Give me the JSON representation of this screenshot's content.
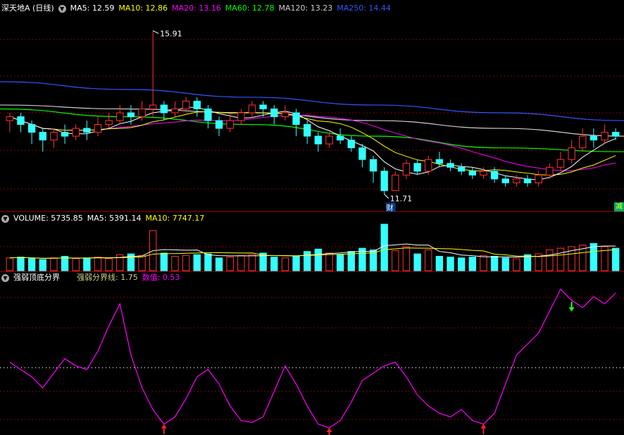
{
  "price_legend": {
    "title": "深天地A (日线)",
    "items": [
      {
        "label": "MA5: 12.59",
        "color": "#ffffff"
      },
      {
        "label": "MA10: 12.86",
        "color": "#ffff00"
      },
      {
        "label": "MA20: 13.16",
        "color": "#ff00ff"
      },
      {
        "label": "MA60: 12.78",
        "color": "#00ff00"
      },
      {
        "label": "MA120: 13.23",
        "color": "#cccccc"
      },
      {
        "label": "MA250: 14.44",
        "color": "#3355ff"
      }
    ]
  },
  "volume_legend": {
    "items": [
      {
        "label": "VOLUME: 5735.85",
        "color": "#ffffff"
      },
      {
        "label": "MA5: 5391.14",
        "color": "#ffffff"
      },
      {
        "label": "MA10: 7747.17",
        "color": "#ffff00"
      }
    ]
  },
  "indicator_legend": {
    "title": "强弱顶底分界",
    "items": [
      {
        "label": "强弱分界线: 1.75",
        "color": "#d0d080"
      },
      {
        "label": "数值: 0.53",
        "color": "#ff00ff"
      }
    ]
  },
  "badge": "减",
  "chart_data": {
    "type": "candlestick",
    "high_label": "15.91",
    "low_label": "11.71",
    "event_marker": "财",
    "colors": {
      "up": "#ff3333",
      "down": "#33ffff",
      "grid": "#8b0000",
      "ma5": "#ffffff",
      "ma10": "#ffff00",
      "ma20": "#ff00ff",
      "ma60": "#00ff00",
      "ma120": "#cccccc",
      "ma250": "#3355ff",
      "indicator": "#ff00ff"
    },
    "candles": [
      [
        13.6,
        13.7,
        13.8,
        13.3
      ],
      [
        13.7,
        13.5,
        13.8,
        13.3
      ],
      [
        13.5,
        13.3,
        13.6,
        13.0
      ],
      [
        13.3,
        13.1,
        13.4,
        12.8
      ],
      [
        13.1,
        13.3,
        13.4,
        12.9
      ],
      [
        13.3,
        13.2,
        13.5,
        13.0
      ],
      [
        13.2,
        13.4,
        13.5,
        13.1
      ],
      [
        13.4,
        13.3,
        13.6,
        13.1
      ],
      [
        13.3,
        13.5,
        13.7,
        13.2
      ],
      [
        13.5,
        13.6,
        13.8,
        13.4
      ],
      [
        13.6,
        13.8,
        14.0,
        13.5
      ],
      [
        13.8,
        13.7,
        14.0,
        13.5
      ],
      [
        13.7,
        13.9,
        14.1,
        13.6
      ],
      [
        13.9,
        14.0,
        15.91,
        13.7
      ],
      [
        14.0,
        13.8,
        14.1,
        13.6
      ],
      [
        13.8,
        13.9,
        14.1,
        13.7
      ],
      [
        13.9,
        14.1,
        14.2,
        13.8
      ],
      [
        14.1,
        13.9,
        14.2,
        13.7
      ],
      [
        13.9,
        13.6,
        14.0,
        13.4
      ],
      [
        13.6,
        13.4,
        13.7,
        13.2
      ],
      [
        13.4,
        13.6,
        13.8,
        13.3
      ],
      [
        13.6,
        13.8,
        13.9,
        13.5
      ],
      [
        13.8,
        14.0,
        14.1,
        13.7
      ],
      [
        14.0,
        13.9,
        14.1,
        13.7
      ],
      [
        13.9,
        13.7,
        14.0,
        13.5
      ],
      [
        13.7,
        13.8,
        14.0,
        13.6
      ],
      [
        13.8,
        13.5,
        13.9,
        13.2
      ],
      [
        13.5,
        13.2,
        13.6,
        13.0
      ],
      [
        13.2,
        13.0,
        13.3,
        12.8
      ],
      [
        13.0,
        13.2,
        13.3,
        12.9
      ],
      [
        13.2,
        13.1,
        13.4,
        13.0
      ],
      [
        13.1,
        12.9,
        13.2,
        12.8
      ],
      [
        12.9,
        12.6,
        13.0,
        12.4
      ],
      [
        12.6,
        12.3,
        12.7,
        12.0
      ],
      [
        12.3,
        11.8,
        12.4,
        11.71
      ],
      [
        11.8,
        12.2,
        12.3,
        11.8
      ],
      [
        12.2,
        12.5,
        12.6,
        12.1
      ],
      [
        12.5,
        12.3,
        12.6,
        12.2
      ],
      [
        12.3,
        12.6,
        12.7,
        12.2
      ],
      [
        12.6,
        12.5,
        12.8,
        12.4
      ],
      [
        12.5,
        12.4,
        12.6,
        12.3
      ],
      [
        12.4,
        12.3,
        12.5,
        12.2
      ],
      [
        12.3,
        12.2,
        12.4,
        12.1
      ],
      [
        12.2,
        12.3,
        12.4,
        12.1
      ],
      [
        12.3,
        12.1,
        12.4,
        12.0
      ],
      [
        12.1,
        12.0,
        12.2,
        11.9
      ],
      [
        12.0,
        12.1,
        12.2,
        11.9
      ],
      [
        12.1,
        12.0,
        12.2,
        11.9
      ],
      [
        12.0,
        12.2,
        12.3,
        11.9
      ],
      [
        12.2,
        12.4,
        12.5,
        12.1
      ],
      [
        12.4,
        12.6,
        12.8,
        12.3
      ],
      [
        12.6,
        12.9,
        13.1,
        12.5
      ],
      [
        12.9,
        13.2,
        13.4,
        12.8
      ],
      [
        13.2,
        13.1,
        13.4,
        12.9
      ],
      [
        13.1,
        13.3,
        13.5,
        13.0
      ],
      [
        13.3,
        13.2,
        13.4,
        13.1
      ]
    ],
    "ma250": [
      14.6,
      14.4,
      14.2,
      14.0,
      13.8,
      13.6
    ],
    "ma120": [
      14.0,
      13.9,
      13.8,
      13.6,
      13.4,
      13.2
    ],
    "ma60": [
      13.9,
      13.7,
      13.5,
      13.2,
      12.9,
      12.8
    ],
    "volume": [
      1.6,
      1.7,
      1.5,
      1.4,
      1.6,
      1.8,
      1.5,
      1.6,
      1.7,
      1.5,
      2.0,
      2.1,
      1.9,
      5.0,
      2.2,
      1.8,
      1.9,
      2.0,
      2.1,
      1.6,
      1.7,
      1.9,
      2.0,
      2.2,
      1.7,
      1.6,
      1.8,
      2.4,
      2.7,
      2.2,
      2.0,
      2.4,
      2.8,
      2.6,
      5.8,
      2.5,
      3.0,
      2.1,
      2.6,
      1.8,
      1.7,
      1.6,
      1.7,
      1.9,
      1.8,
      1.6,
      1.5,
      2.0,
      2.1,
      2.6,
      2.8,
      3.0,
      3.2,
      3.4,
      3.0,
      2.8
    ],
    "indicator": [
      1.9,
      1.7,
      1.5,
      1.2,
      1.6,
      2.0,
      1.8,
      1.7,
      2.2,
      2.9,
      3.5,
      2.1,
      1.2,
      0.6,
      0.2,
      0.4,
      0.9,
      1.5,
      1.7,
      1.3,
      0.7,
      0.3,
      0.25,
      0.4,
      1.1,
      1.8,
      1.3,
      0.7,
      0.2,
      0.1,
      0.3,
      0.8,
      1.4,
      1.6,
      1.8,
      1.9,
      1.5,
      1.0,
      0.7,
      0.5,
      0.4,
      0.6,
      0.3,
      0.2,
      0.5,
      1.3,
      2.1,
      2.4,
      2.7,
      3.3,
      3.9,
      3.6,
      3.4,
      3.7,
      3.5,
      3.8
    ],
    "indicator_threshold": 1.75,
    "signals": [
      {
        "index": 14,
        "type": "buy"
      },
      {
        "index": 29,
        "type": "buy"
      },
      {
        "index": 43,
        "type": "buy"
      },
      {
        "index": 51,
        "type": "sell"
      }
    ]
  }
}
